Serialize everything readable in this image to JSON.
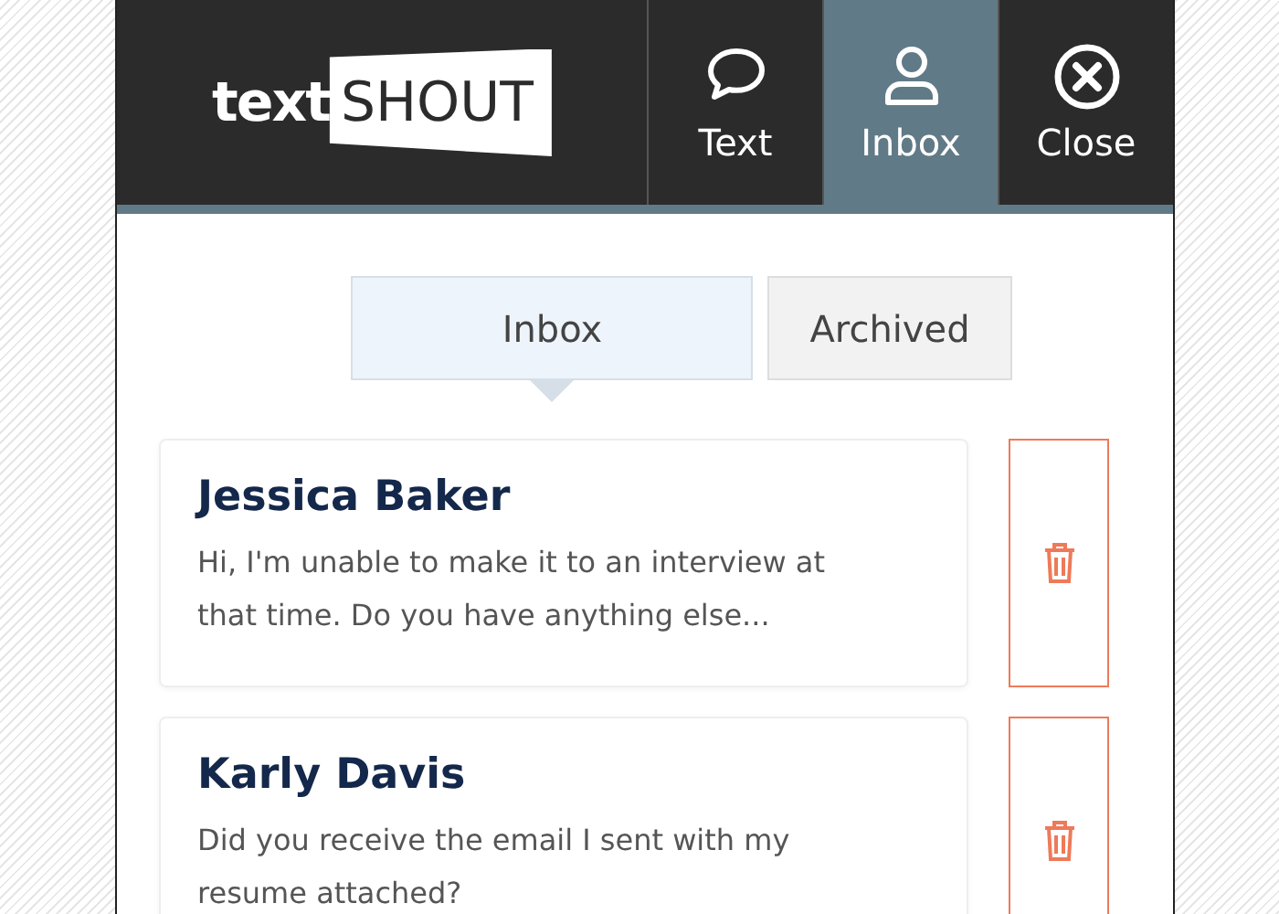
{
  "header": {
    "logo": {
      "plain": "text",
      "badge": "SHOUT"
    },
    "nav": [
      {
        "label": "Text",
        "kind": "chat",
        "selected": false
      },
      {
        "label": "Inbox",
        "kind": "person",
        "selected": true
      },
      {
        "label": "Close",
        "kind": "close",
        "selected": false
      }
    ]
  },
  "tabs": [
    {
      "label": "Inbox",
      "selected": true
    },
    {
      "label": "Archived",
      "selected": false
    }
  ],
  "messages": [
    {
      "name": "Jessica Baker",
      "text": "Hi, I'm unable to make it to an interview at that time. Do you have anything else..."
    },
    {
      "name": "Karly Davis",
      "text": "Did you receive the email I sent with my resume attached?"
    }
  ]
}
